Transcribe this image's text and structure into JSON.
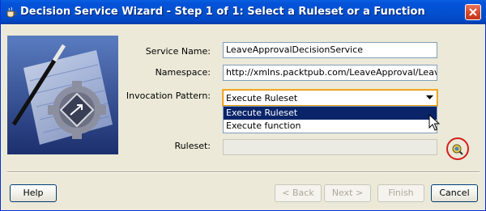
{
  "window": {
    "title": "Decision Service Wizard - Step 1 of 1: Select a Ruleset or a Function"
  },
  "form": {
    "service_name_label": "Service Name:",
    "service_name_value": "LeaveApprovalDecisionService",
    "namespace_label": "Namespace:",
    "namespace_value": "http://xmlns.packtpub.com/LeaveApproval/LeaveApp",
    "invocation_pattern_label": "Invocation Pattern:",
    "invocation_pattern_value": "Execute Ruleset",
    "invocation_options": [
      "Execute Ruleset",
      "Execute function"
    ],
    "ruleset_label": "Ruleset:",
    "ruleset_value": ""
  },
  "buttons": {
    "help": "Help",
    "back": "< Back",
    "next": "Next >",
    "finish": "Finish",
    "cancel": "Cancel"
  },
  "icons": {
    "app": "cup-icon",
    "close": "close-icon",
    "browse": "browse-icon",
    "wizard": "wizard-wand-gear-image",
    "cursor": "mouse-cursor"
  },
  "colors": {
    "titlebar": "#0452d8",
    "close": "#d6492a",
    "selection": "#0a246a",
    "highlight_circle": "#d41f1f"
  }
}
